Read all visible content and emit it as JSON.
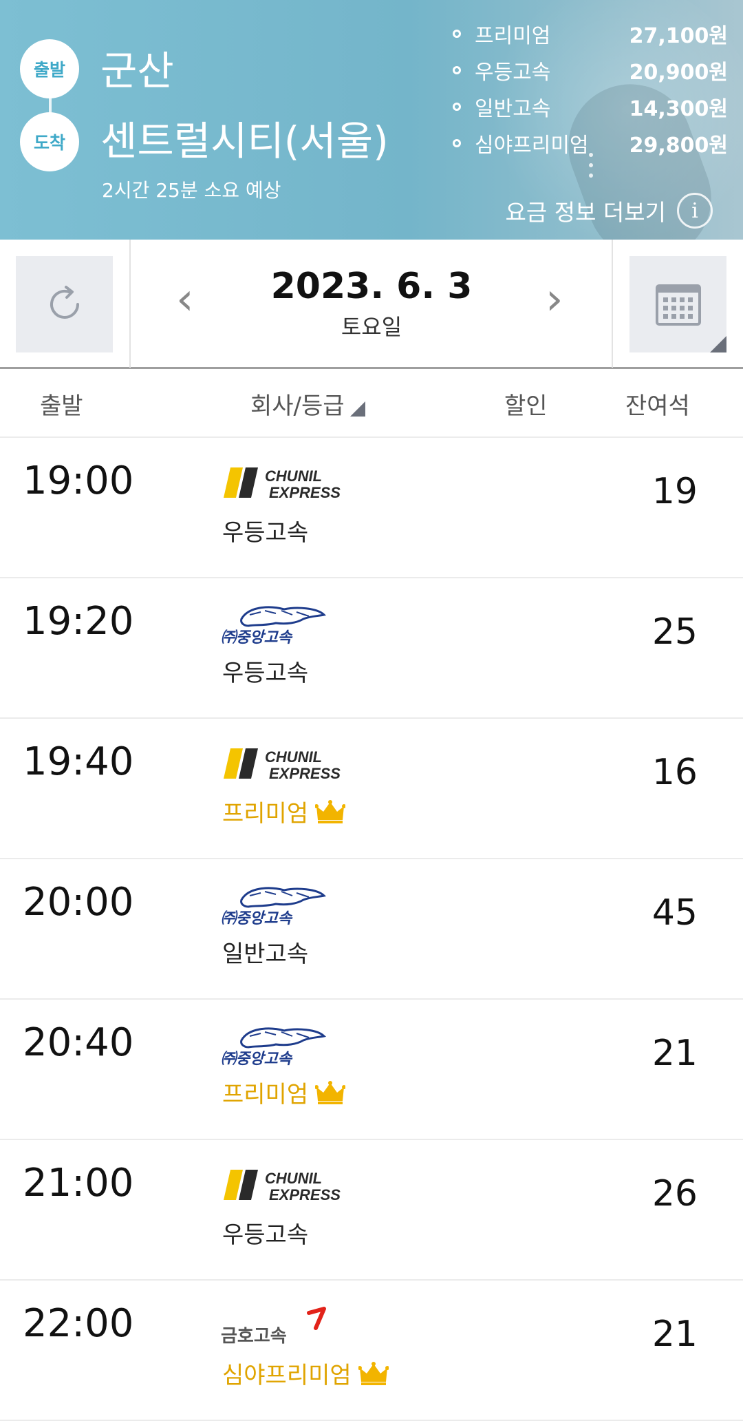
{
  "route": {
    "dep_badge": "출발",
    "arr_badge": "도착",
    "departure": "군산",
    "arrival": "센트럴시티(서울)",
    "duration": "2시간 25분 소요 예상"
  },
  "fares": [
    {
      "name": "프리미엄",
      "price": "27,100원"
    },
    {
      "name": "우등고속",
      "price": "20,900원"
    },
    {
      "name": "일반고속",
      "price": "14,300원"
    },
    {
      "name": "심야프리미엄",
      "price": "29,800원"
    }
  ],
  "fare_more": "요금 정보 더보기",
  "fare_info_icon": "i",
  "date": {
    "value": "2023. 6. 3",
    "day": "토요일",
    "prev": "‹",
    "next": "›"
  },
  "table_header": {
    "departure": "출발",
    "company": "회사/등급",
    "discount": "할인",
    "seats": "잔여석"
  },
  "companies": {
    "chunil_line1": "CHUNIL",
    "chunil_line2": "EXPRESS",
    "jungang": "㈜중앙고속",
    "kumho": "금호고속"
  },
  "buses": [
    {
      "time": "19:00",
      "company": "chunil",
      "grade": "우등고속",
      "premium": false,
      "seats": "19"
    },
    {
      "time": "19:20",
      "company": "jungang",
      "grade": "우등고속",
      "premium": false,
      "seats": "25"
    },
    {
      "time": "19:40",
      "company": "chunil",
      "grade": "프리미엄",
      "premium": true,
      "seats": "16"
    },
    {
      "time": "20:00",
      "company": "jungang",
      "grade": "일반고속",
      "premium": false,
      "seats": "45"
    },
    {
      "time": "20:40",
      "company": "jungang",
      "grade": "프리미엄",
      "premium": true,
      "seats": "21"
    },
    {
      "time": "21:00",
      "company": "chunil",
      "grade": "우등고속",
      "premium": false,
      "seats": "26"
    },
    {
      "time": "22:00",
      "company": "kumho",
      "grade": "심야프리미엄",
      "premium": true,
      "seats": "21"
    }
  ],
  "colors": {
    "header_bg": "#7dbfd3",
    "badge_text": "#3fa9c8",
    "premium": "#e0a400",
    "chunil_yellow": "#f4c400",
    "jungang_blue": "#1e3c8c",
    "kumho_red": "#e2231a"
  }
}
